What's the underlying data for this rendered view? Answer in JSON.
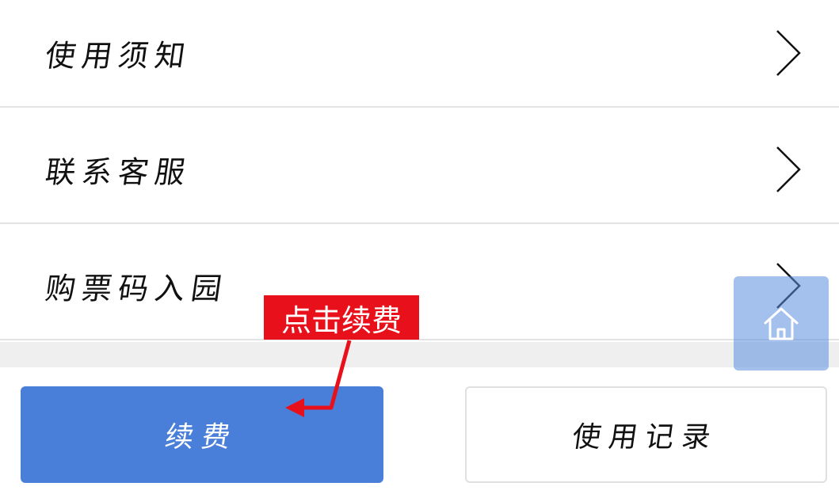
{
  "menu": {
    "items": [
      {
        "label": "使用须知"
      },
      {
        "label": "联系客服"
      },
      {
        "label": "购票码入园"
      }
    ]
  },
  "buttons": {
    "renew_label": "续费",
    "records_label": "使用记录"
  },
  "annotation": {
    "text": "点击续费",
    "color": "#e8101a"
  },
  "colors": {
    "primary": "#4a7fd9",
    "divider": "#e3e3e3"
  },
  "icons": {
    "chevron": "chevron-right-icon",
    "home": "home-icon"
  }
}
